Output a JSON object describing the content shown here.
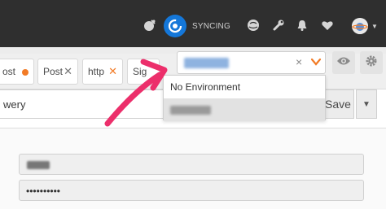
{
  "header": {
    "sync_label": "SYNCING",
    "icons": [
      "satellite-icon",
      "sync-icon",
      "globe-icon",
      "wrench-icon",
      "bell-icon",
      "heart-icon",
      "avatar"
    ]
  },
  "tabs": [
    {
      "label": "ost",
      "indicator": "dot"
    },
    {
      "label": "Post",
      "indicator": "close"
    },
    {
      "label": "http",
      "indicator": "close-orange"
    },
    {
      "label": "Sig",
      "indicator": "none"
    }
  ],
  "environment": {
    "selected": "",
    "clear_glyph": "×",
    "options": [
      "No Environment",
      ""
    ]
  },
  "request": {
    "text": "wery",
    "save_label": "Save"
  },
  "form": {
    "password_value": "••••••••••"
  },
  "colors": {
    "topbar": "#2f2f2f",
    "accent": "#f27b26",
    "sync_blue": "#1477d9",
    "arrow": "#ec2f6b"
  }
}
